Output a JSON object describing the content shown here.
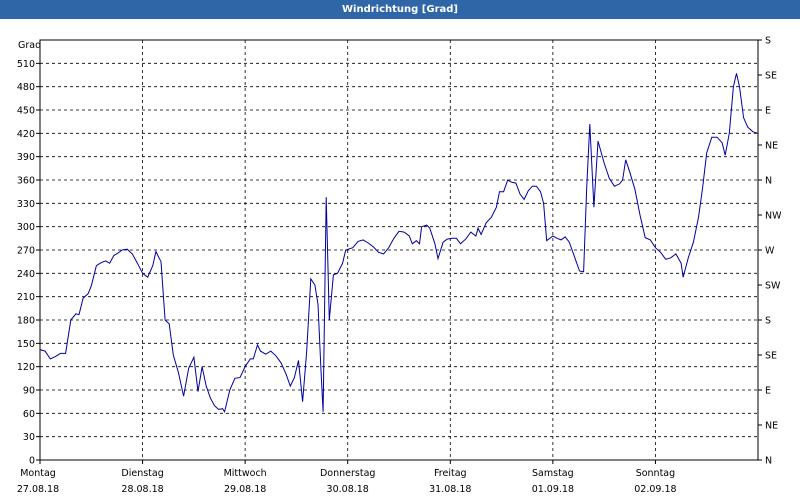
{
  "window": {
    "title": "Windrichtung [Grad]"
  },
  "chart_data": {
    "type": "line",
    "title": "Windrichtung [Grad]",
    "ylabel": "Grad",
    "ylim": [
      0,
      540
    ],
    "y_ticks": [
      0,
      30,
      60,
      90,
      120,
      150,
      180,
      210,
      240,
      270,
      300,
      330,
      360,
      390,
      420,
      450,
      480,
      510
    ],
    "right_axis": {
      "labels": [
        "N",
        "NE",
        "E",
        "SE",
        "S",
        "SW",
        "W",
        "NW",
        "N",
        "NE",
        "E",
        "SE",
        "S"
      ],
      "values": [
        0,
        45,
        90,
        135,
        180,
        225,
        270,
        315,
        360,
        405,
        450,
        495,
        540
      ]
    },
    "xlim": [
      0,
      7
    ],
    "x_unit": "days from Montag 27.08.18 00:00",
    "x_ticks": [
      {
        "day": "Montag",
        "date": "27.08.18",
        "x": 0
      },
      {
        "day": "Dienstag",
        "date": "28.08.18",
        "x": 1
      },
      {
        "day": "Mittwoch",
        "date": "29.08.18",
        "x": 2
      },
      {
        "day": "Donnerstag",
        "date": "30.08.18",
        "x": 3
      },
      {
        "day": "Freitag",
        "date": "31.08.18",
        "x": 4
      },
      {
        "day": "Samstag",
        "date": "01.09.18",
        "x": 5
      },
      {
        "day": "Sonntag",
        "date": "02.09.18",
        "x": 6
      }
    ],
    "grid": true,
    "line_color": "#0000a0",
    "series": [
      {
        "name": "",
        "points": [
          [
            0.0,
            142
          ],
          [
            0.05,
            140
          ],
          [
            0.1,
            130
          ],
          [
            0.15,
            133
          ],
          [
            0.2,
            137
          ],
          [
            0.25,
            137
          ],
          [
            0.3,
            180
          ],
          [
            0.35,
            188
          ],
          [
            0.38,
            187
          ],
          [
            0.42,
            208
          ],
          [
            0.47,
            214
          ],
          [
            0.5,
            224
          ],
          [
            0.55,
            250
          ],
          [
            0.6,
            254
          ],
          [
            0.64,
            256
          ],
          [
            0.68,
            253
          ],
          [
            0.72,
            263
          ],
          [
            0.76,
            266
          ],
          [
            0.8,
            270
          ],
          [
            0.85,
            271
          ],
          [
            0.9,
            265
          ],
          [
            0.95,
            253
          ],
          [
            1.0,
            240
          ],
          [
            1.05,
            235
          ],
          [
            1.1,
            250
          ],
          [
            1.13,
            268
          ],
          [
            1.18,
            255
          ],
          [
            1.22,
            180
          ],
          [
            1.26,
            175
          ],
          [
            1.3,
            135
          ],
          [
            1.35,
            112
          ],
          [
            1.4,
            82
          ],
          [
            1.45,
            118
          ],
          [
            1.5,
            132
          ],
          [
            1.54,
            88
          ],
          [
            1.58,
            120
          ],
          [
            1.62,
            95
          ],
          [
            1.66,
            80
          ],
          [
            1.7,
            70
          ],
          [
            1.74,
            65
          ],
          [
            1.78,
            66
          ],
          [
            1.8,
            62
          ],
          [
            1.85,
            90
          ],
          [
            1.9,
            105
          ],
          [
            1.95,
            106
          ],
          [
            2.0,
            120
          ],
          [
            2.05,
            130
          ],
          [
            2.08,
            130
          ],
          [
            2.12,
            148
          ],
          [
            2.15,
            140
          ],
          [
            2.2,
            136
          ],
          [
            2.25,
            140
          ],
          [
            2.3,
            134
          ],
          [
            2.35,
            125
          ],
          [
            2.4,
            110
          ],
          [
            2.44,
            95
          ],
          [
            2.48,
            106
          ],
          [
            2.52,
            128
          ],
          [
            2.56,
            75
          ],
          [
            2.6,
            140
          ],
          [
            2.64,
            233
          ],
          [
            2.68,
            225
          ],
          [
            2.71,
            200
          ],
          [
            2.74,
            115
          ],
          [
            2.76,
            62
          ],
          [
            2.79,
            338
          ],
          [
            2.82,
            180
          ],
          [
            2.86,
            238
          ],
          [
            2.9,
            240
          ],
          [
            2.95,
            253
          ],
          [
            2.98,
            270
          ],
          [
            3.05,
            273
          ],
          [
            3.1,
            281
          ],
          [
            3.15,
            283
          ],
          [
            3.2,
            279
          ],
          [
            3.25,
            274
          ],
          [
            3.3,
            267
          ],
          [
            3.35,
            265
          ],
          [
            3.4,
            273
          ],
          [
            3.45,
            285
          ],
          [
            3.5,
            294
          ],
          [
            3.55,
            293
          ],
          [
            3.6,
            288
          ],
          [
            3.63,
            278
          ],
          [
            3.67,
            282
          ],
          [
            3.7,
            278
          ],
          [
            3.72,
            300
          ],
          [
            3.77,
            302
          ],
          [
            3.8,
            298
          ],
          [
            3.85,
            278
          ],
          [
            3.88,
            259
          ],
          [
            3.93,
            280
          ],
          [
            3.97,
            284
          ],
          [
            4.02,
            285
          ],
          [
            4.06,
            285
          ],
          [
            4.1,
            278
          ],
          [
            4.15,
            284
          ],
          [
            4.2,
            293
          ],
          [
            4.25,
            288
          ],
          [
            4.27,
            298
          ],
          [
            4.3,
            290
          ],
          [
            4.35,
            305
          ],
          [
            4.4,
            312
          ],
          [
            4.45,
            325
          ],
          [
            4.48,
            345
          ],
          [
            4.52,
            345
          ],
          [
            4.56,
            360
          ],
          [
            4.6,
            357
          ],
          [
            4.64,
            356
          ],
          [
            4.68,
            342
          ],
          [
            4.72,
            335
          ],
          [
            4.76,
            346
          ],
          [
            4.8,
            352
          ],
          [
            4.84,
            352
          ],
          [
            4.88,
            345
          ],
          [
            4.91,
            330
          ],
          [
            4.94,
            282
          ],
          [
            5.0,
            288
          ],
          [
            5.04,
            285
          ],
          [
            5.08,
            283
          ],
          [
            5.12,
            287
          ],
          [
            5.16,
            280
          ],
          [
            5.22,
            258
          ],
          [
            5.26,
            243
          ],
          [
            5.3,
            242
          ],
          [
            5.33,
            350
          ],
          [
            5.36,
            432
          ],
          [
            5.4,
            325
          ],
          [
            5.44,
            410
          ],
          [
            5.5,
            382
          ],
          [
            5.55,
            362
          ],
          [
            5.6,
            352
          ],
          [
            5.65,
            355
          ],
          [
            5.68,
            360
          ],
          [
            5.71,
            386
          ],
          [
            5.75,
            370
          ],
          [
            5.8,
            348
          ],
          [
            5.85,
            315
          ],
          [
            5.9,
            286
          ],
          [
            5.95,
            283
          ],
          [
            6.0,
            273
          ],
          [
            6.05,
            267
          ],
          [
            6.1,
            258
          ],
          [
            6.15,
            260
          ],
          [
            6.2,
            265
          ],
          [
            6.25,
            253
          ],
          [
            6.27,
            235
          ],
          [
            6.32,
            260
          ],
          [
            6.37,
            280
          ],
          [
            6.42,
            312
          ],
          [
            6.46,
            350
          ],
          [
            6.5,
            395
          ],
          [
            6.55,
            415
          ],
          [
            6.6,
            415
          ],
          [
            6.65,
            408
          ],
          [
            6.68,
            392
          ],
          [
            6.72,
            420
          ],
          [
            6.76,
            480
          ],
          [
            6.79,
            497
          ],
          [
            6.82,
            480
          ],
          [
            6.86,
            440
          ],
          [
            6.9,
            428
          ],
          [
            6.95,
            422
          ],
          [
            7.0,
            420
          ]
        ]
      }
    ]
  }
}
